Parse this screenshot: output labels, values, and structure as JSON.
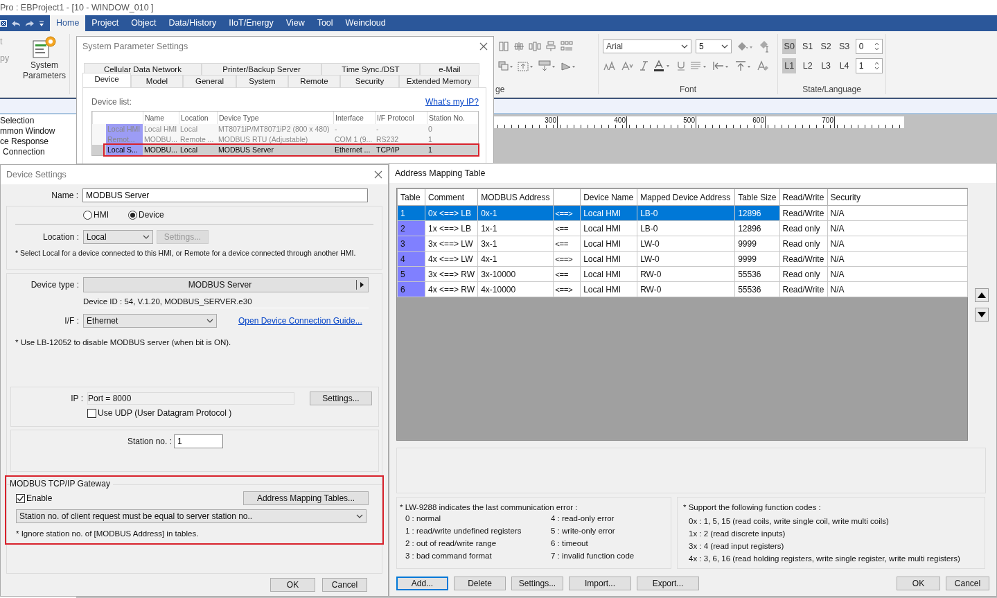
{
  "app": {
    "title": "Pro : EBProject1 - [10 - WINDOW_010 ]"
  },
  "ribbon": {
    "tabs": [
      {
        "label": "Home",
        "selected": true
      },
      {
        "label": "Project",
        "selected": false
      },
      {
        "label": "Object",
        "selected": false
      },
      {
        "label": "Data/History",
        "selected": false
      },
      {
        "label": "IIoT/Energy",
        "selected": false
      },
      {
        "label": "View",
        "selected": false
      },
      {
        "label": "Tool",
        "selected": false
      },
      {
        "label": "Weincloud",
        "selected": false
      }
    ],
    "clipboard_fragments": [
      "t",
      "py"
    ],
    "system_parameters_button": "System Parameters",
    "arrange_fragment": "ge",
    "font": {
      "name": "Arial",
      "size": "5",
      "group_label": "Font"
    },
    "state_language": {
      "states": [
        {
          "label": "S0",
          "selected": true
        },
        {
          "label": "S1",
          "selected": false
        },
        {
          "label": "S2",
          "selected": false
        },
        {
          "label": "S3",
          "selected": false
        }
      ],
      "state_value": "0",
      "languages": [
        {
          "label": "L1",
          "selected": true
        },
        {
          "label": "L2",
          "selected": false
        },
        {
          "label": "L3",
          "selected": false
        },
        {
          "label": "L4",
          "selected": false
        }
      ],
      "language_value": "1",
      "group_label": "State/Language"
    }
  },
  "sidebar": {
    "items": [
      "Selection",
      "mmon Window",
      "ce Response",
      "Connection"
    ]
  },
  "ruler": {
    "ticks": [
      "300",
      "400",
      "500",
      "600",
      "700"
    ]
  },
  "system_parameter_settings": {
    "title": "System Parameter Settings",
    "back_tabs": [
      {
        "label": "Cellular Data Network",
        "selected": false
      },
      {
        "label": "Printer/Backup Server",
        "selected": false
      },
      {
        "label": "Time Sync./DST",
        "selected": false
      },
      {
        "label": "e-Mail",
        "selected": false
      }
    ],
    "front_tabs": [
      {
        "label": "Device",
        "selected": true
      },
      {
        "label": "Model",
        "selected": false
      },
      {
        "label": "General",
        "selected": false
      },
      {
        "label": "System",
        "selected": false
      },
      {
        "label": "Remote",
        "selected": false
      },
      {
        "label": "Security",
        "selected": false
      },
      {
        "label": "Extended Memory",
        "selected": false
      }
    ],
    "device_list_label": "Device list:",
    "whats_my_ip_link": "What's my IP?",
    "columns": [
      "Name",
      "Location",
      "Device Type",
      "Interface",
      "I/F Protocol",
      "Station No."
    ],
    "rows": [
      {
        "id_label": "Local HMI",
        "cells": [
          "Local HMI",
          "Local",
          "MT8071iP/MT8071iP2 (800 x 480)",
          "-",
          "-",
          "0"
        ],
        "dimmed": true,
        "selected": false
      },
      {
        "id_label": "Remot...",
        "cells": [
          "MODBU...",
          "Remote ...",
          "MODBUS RTU (Adjustable)",
          "COM 1 (9...",
          "RS232",
          "1"
        ],
        "dimmed": true,
        "selected": false
      },
      {
        "id_label": "Local S...",
        "cells": [
          "MODBU...",
          "Local",
          "MODBUS Server",
          "Ethernet ...",
          "TCP/IP",
          "1"
        ],
        "dimmed": false,
        "selected": true
      }
    ]
  },
  "device_settings": {
    "title": "Device Settings",
    "name_label": "Name :",
    "name_value": "MODBUS Server",
    "role_options": [
      {
        "label": "HMI",
        "selected": false
      },
      {
        "label": "Device",
        "selected": true
      }
    ],
    "location_label": "Location :",
    "location_value": "Local",
    "location_settings_button": {
      "label": "Settings...",
      "disabled": true
    },
    "location_note": "* Select Local for a device connected to this HMI, or Remote for a device connected through another HMI.",
    "device_type_label": "Device type :",
    "device_type_value": "MODBUS Server",
    "device_id": "Device ID : 54, V.1.20, MODBUS_SERVER.e30",
    "interface_label": "I/F :",
    "interface_value": "Ethernet",
    "guide_link": "Open Device Connection Guide...",
    "lb_note": "* Use LB-12052 to disable MODBUS server (when bit is ON).",
    "ip_label": "IP :",
    "ip_value": "Port = 8000",
    "ip_settings_button": "Settings...",
    "udp": {
      "label": "Use UDP (User Datagram Protocol )",
      "checked": false
    },
    "station_label": "Station no. :",
    "station_value": "1",
    "gateway": {
      "title": "MODBUS TCP/IP Gateway",
      "enable": {
        "label": "Enable",
        "checked": true
      },
      "mapping_button": "Address Mapping Tables...",
      "station_mode": "Station no. of client request must be equal to server station no..",
      "note": "* Ignore station no. of [MODBUS Address] in tables."
    },
    "buttons": [
      "OK",
      "Cancel"
    ]
  },
  "address_mapping_table": {
    "title": "Address Mapping Table",
    "columns": [
      {
        "label": "Table"
      },
      {
        "label": "Comment"
      },
      {
        "label": "MODBUS Address"
      },
      {
        "kind": "direction"
      },
      {
        "label": "Device Name"
      },
      {
        "label": "Mapped Device Address"
      },
      {
        "label": "Table Size"
      },
      {
        "label": "Read/Write"
      },
      {
        "label": "Security"
      }
    ],
    "rows": [
      {
        "table": "1",
        "comment": "0x <==> LB",
        "modbus_address": "0x-1",
        "direction": "<==>",
        "device_name": "Local HMI",
        "mapped_address": "LB-0",
        "table_size": "12896",
        "read_write": "Read/Write",
        "security": "N/A",
        "selected": true
      },
      {
        "table": "2",
        "comment": "1x <==> LB",
        "modbus_address": "1x-1",
        "direction": "<==",
        "device_name": "Local HMI",
        "mapped_address": "LB-0",
        "table_size": "12896",
        "read_write": "Read only",
        "security": "N/A",
        "selected": false
      },
      {
        "table": "3",
        "comment": "3x <==> LW",
        "modbus_address": "3x-1",
        "direction": "<==",
        "device_name": "Local HMI",
        "mapped_address": "LW-0",
        "table_size": "9999",
        "read_write": "Read only",
        "security": "N/A",
        "selected": false
      },
      {
        "table": "4",
        "comment": "4x <==> LW",
        "modbus_address": "4x-1",
        "direction": "<==>",
        "device_name": "Local HMI",
        "mapped_address": "LW-0",
        "table_size": "9999",
        "read_write": "Read/Write",
        "security": "N/A",
        "selected": false
      },
      {
        "table": "5",
        "comment": "3x <==> RW",
        "modbus_address": "3x-10000",
        "direction": "<==",
        "device_name": "Local HMI",
        "mapped_address": "RW-0",
        "table_size": "55536",
        "read_write": "Read only",
        "security": "N/A",
        "selected": false
      },
      {
        "table": "6",
        "comment": "4x <==> RW",
        "modbus_address": "4x-10000",
        "direction": "<==>",
        "device_name": "Local HMI",
        "mapped_address": "RW-0",
        "table_size": "55536",
        "read_write": "Read/Write",
        "security": "N/A",
        "selected": false
      }
    ],
    "error_note": {
      "title": "* LW-9288 indicates the last communication error :",
      "codes": [
        "0 : normal",
        "1 : read/write undefined registers",
        "2 : out of read/write range",
        "3 : bad command format",
        "4 : read-only error",
        "5 : write-only error",
        "6 : timeout",
        "7 : invalid function code"
      ]
    },
    "function_note": {
      "title": "* Support the following function codes :",
      "codes": [
        "0x : 1, 5, 15 (read coils, write single coil, write multi coils)",
        "1x : 2 (read discrete inputs)",
        "3x : 4 (read input registers)",
        "4x : 3, 6, 16 (read holding registers, write single register, write multi registers)"
      ]
    },
    "left_buttons": [
      "Add...",
      "Delete",
      "Settings...",
      "Import...",
      "Export..."
    ],
    "right_buttons": [
      "OK",
      "Cancel"
    ]
  }
}
